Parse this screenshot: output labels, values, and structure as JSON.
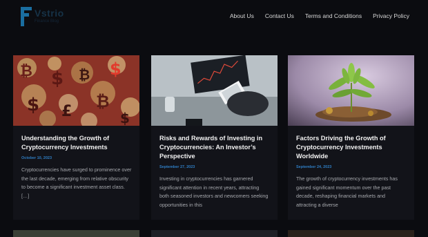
{
  "brand": {
    "name": "Vstrio",
    "tagline": "Finance Blog"
  },
  "nav": [
    {
      "label": "About Us"
    },
    {
      "label": "Contact Us"
    },
    {
      "label": "Terms and Conditions"
    },
    {
      "label": "Privacy Policy"
    }
  ],
  "posts": [
    {
      "title": "Understanding the Growth of Cryptocurrency Investments",
      "date": "October 10, 2023",
      "excerpt": "Cryptocurrencies have surged to prominence over the last decade, emerging from relative obscurity to become a significant investment asset class. […]"
    },
    {
      "title": "Risks and Rewards of Investing in Cryptocurrencies: An Investor’s Perspective",
      "date": "September 27, 2023",
      "excerpt": "Investing in cryptocurrencies has garnered significant attention in recent years, attracting both seasoned investors and newcomers seeking opportunities in this"
    },
    {
      "title": "Factors Driving the Growth of Cryptocurrency Investments Worldwide",
      "date": "September 24, 2023",
      "excerpt": "The growth of cryptocurrency investments has gained significant momentum over the past decade, reshaping financial markets and attracting a diverse"
    }
  ]
}
